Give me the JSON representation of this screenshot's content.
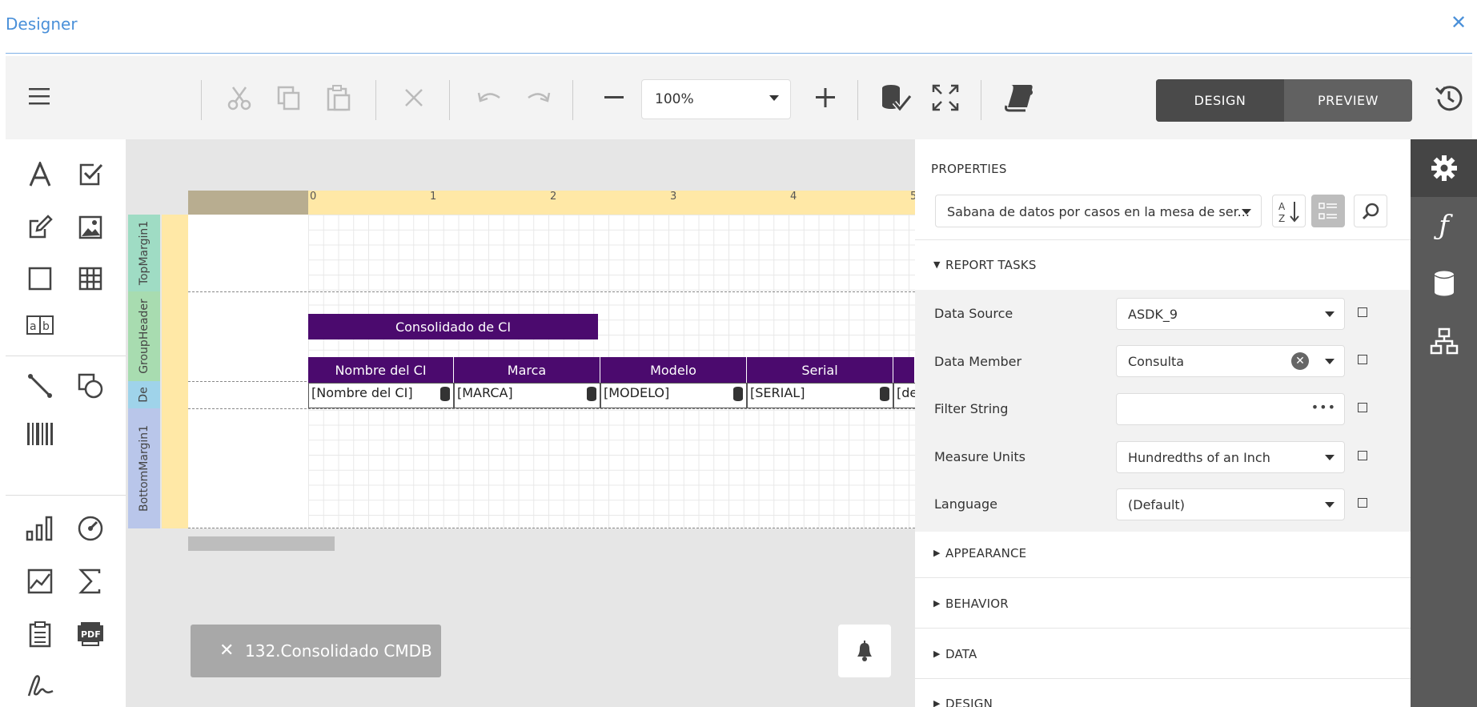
{
  "window": {
    "title": "Designer"
  },
  "toolbar": {
    "zoom_value": "100%",
    "mode_design": "DESIGN",
    "mode_preview": "PREVIEW"
  },
  "ruler": {
    "marks": [
      "0",
      "1",
      "2",
      "3",
      "4",
      "5"
    ]
  },
  "bands": {
    "top_margin": "TopMargin1",
    "group_header": "GroupHeader",
    "detail": "De",
    "bottom_margin": "BottomMargin1"
  },
  "report": {
    "title": "Consolidado de CI",
    "headers": [
      "Nombre del CI",
      "Marca",
      "Modelo",
      "Serial"
    ],
    "fields": [
      "[Nombre del CI]",
      "[MARCA]",
      "[MODELO]",
      "[SERIAL]",
      "[de"
    ]
  },
  "tab": {
    "label": "132.Consolidado CMDB"
  },
  "properties": {
    "title": "PROPERTIES",
    "selected_object": "Sabana de datos por casos en la mesa de ser...",
    "sections": {
      "report_tasks": "REPORT TASKS",
      "appearance": "APPEARANCE",
      "behavior": "BEHAVIOR",
      "data": "DATA",
      "design": "DESIGN"
    },
    "rows": {
      "data_source": {
        "label": "Data Source",
        "value": "ASDK_9"
      },
      "data_member": {
        "label": "Data Member",
        "value": "Consulta"
      },
      "filter_string": {
        "label": "Filter String",
        "value": ""
      },
      "measure_units": {
        "label": "Measure Units",
        "value": "Hundredths of an Inch"
      },
      "language": {
        "label": "Language",
        "value": "(Default)"
      }
    }
  },
  "colors": {
    "accent": "#4a90d9",
    "band_purple": "#4b0a6e",
    "ruler": "#ffe8a6",
    "rightbar": "#5a5a5a"
  }
}
